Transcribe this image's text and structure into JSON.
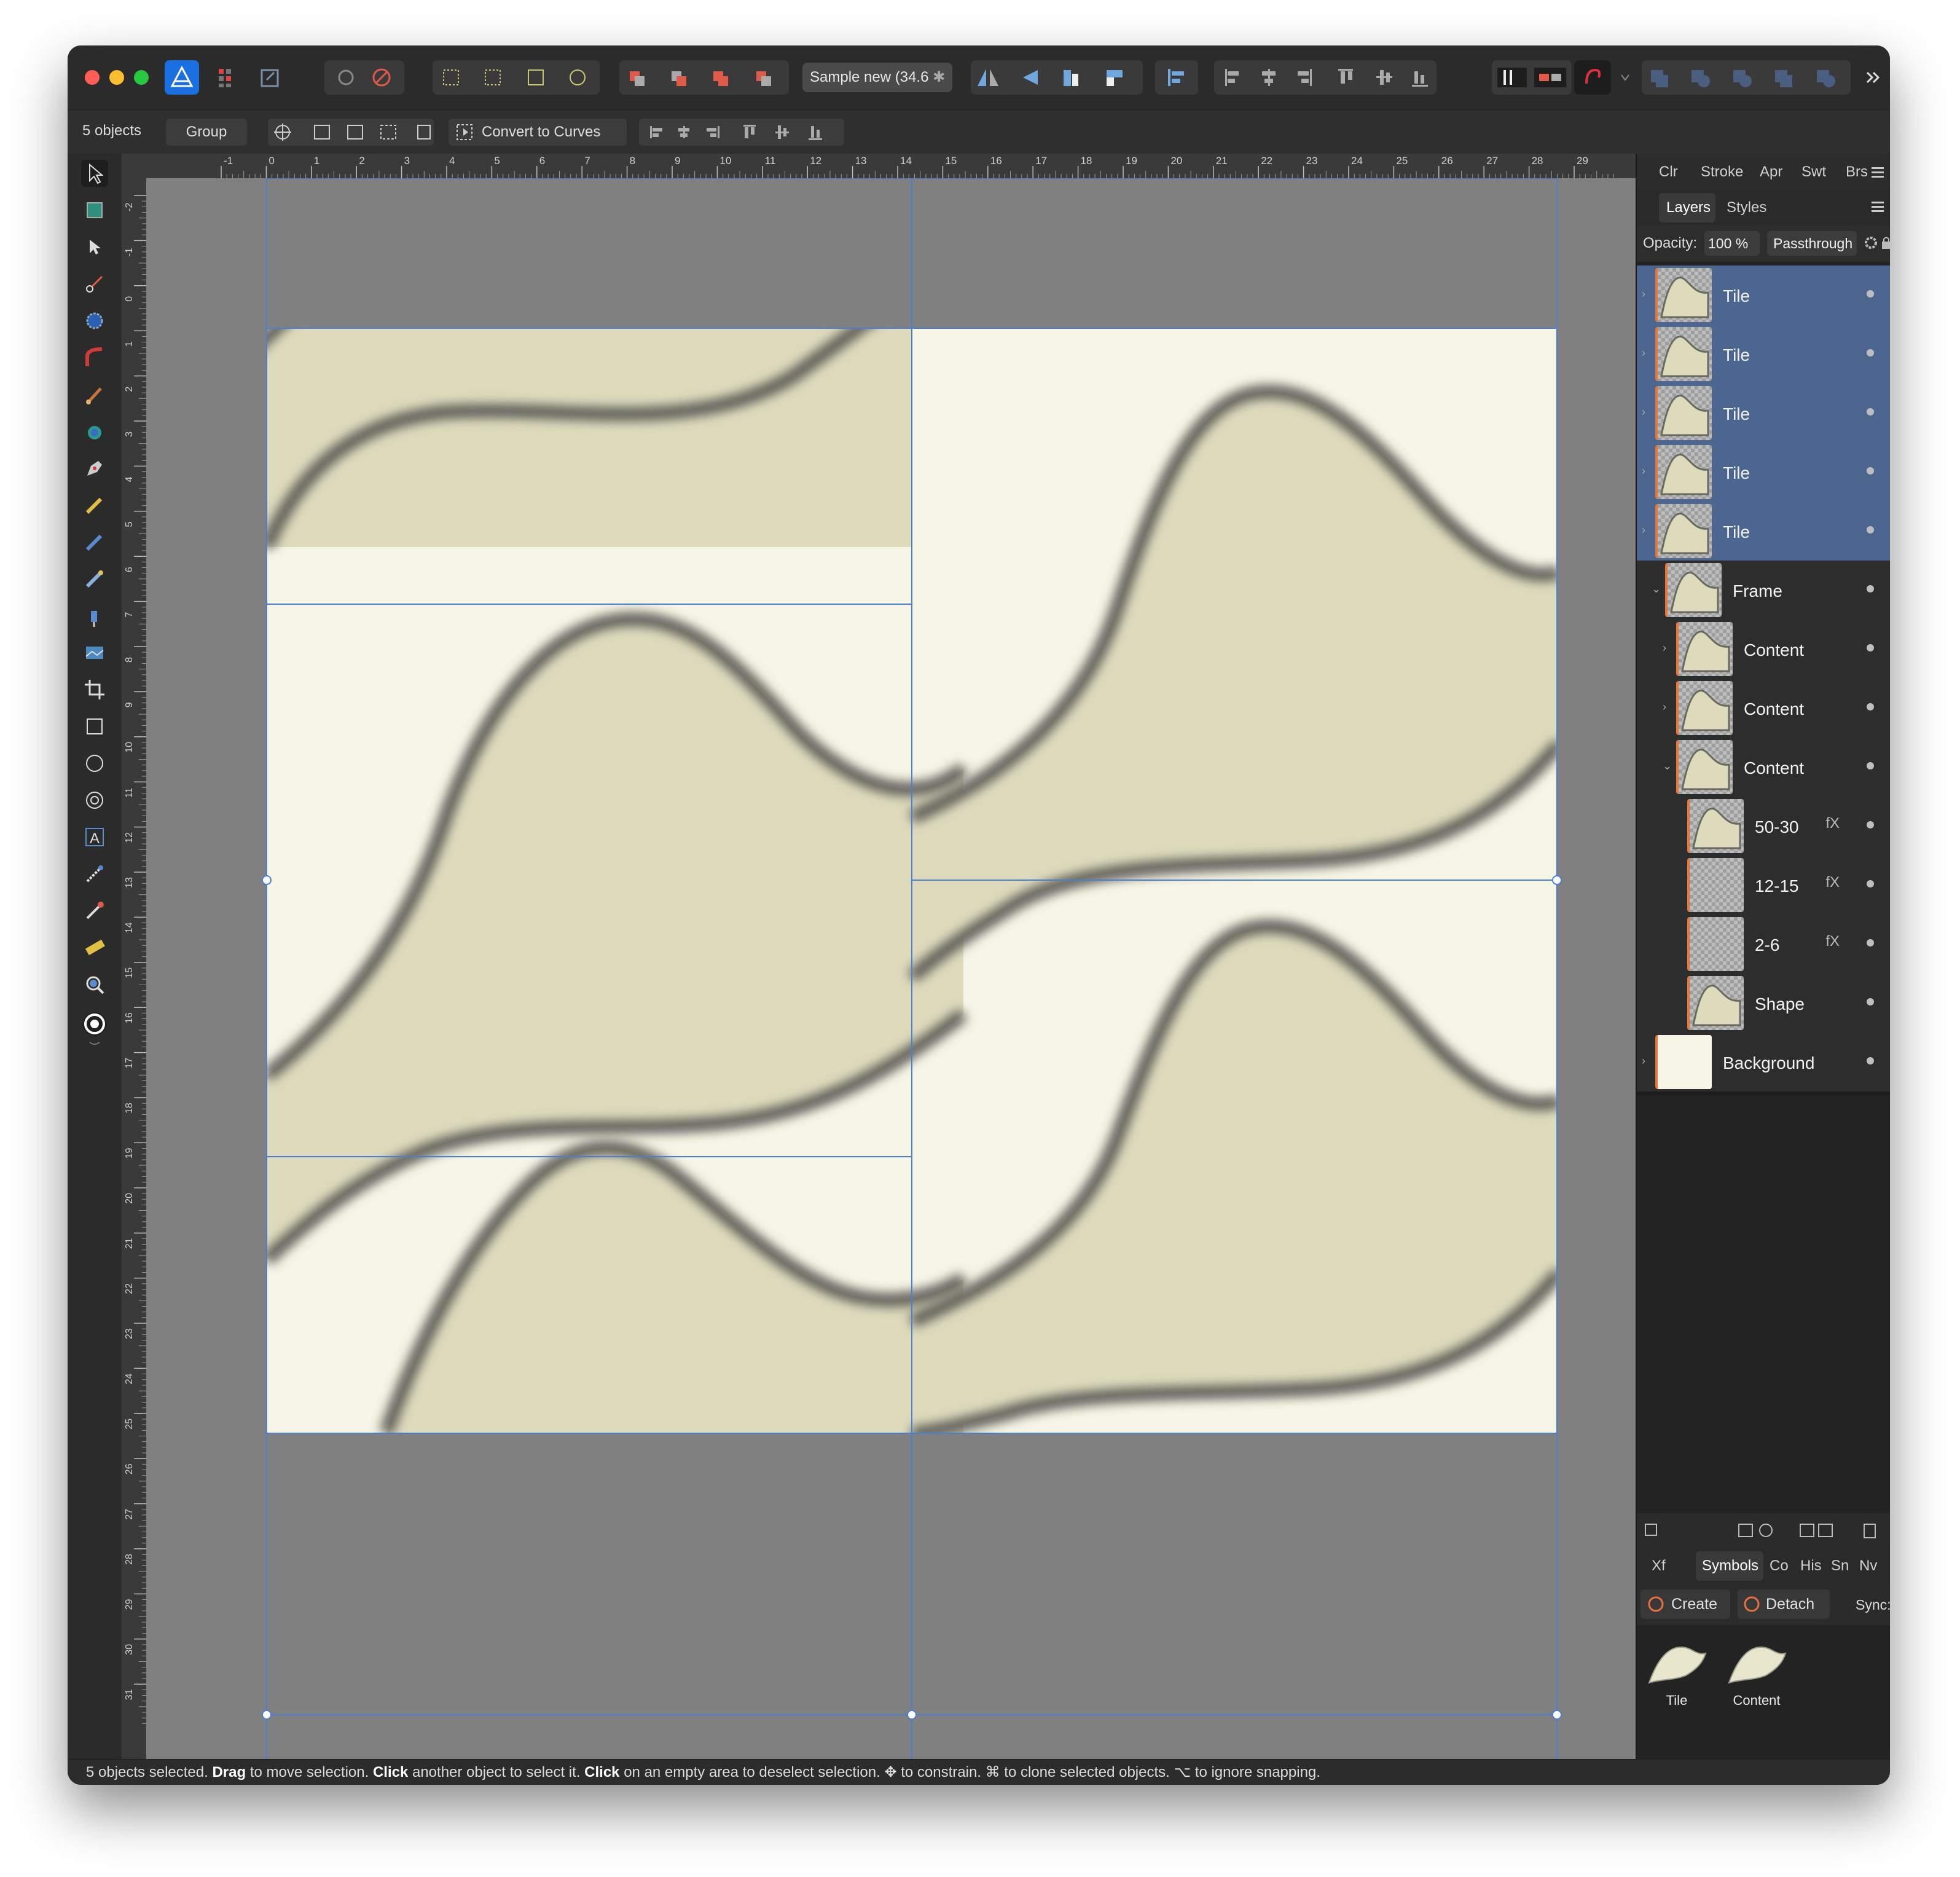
{
  "toolbar": {
    "document_title": "Sample new (34.6",
    "document_title_suffix": "✱"
  },
  "context_bar": {
    "selection_count": "5 objects",
    "group_label": "Group",
    "convert_label": "Convert to Curves"
  },
  "rulers": {
    "unit": "in",
    "h_ticks": [
      "-1",
      "0",
      "1",
      "2",
      "3",
      "4",
      "5",
      "6",
      "7",
      "8",
      "9",
      "10",
      "11",
      "12",
      "13",
      "14",
      "15",
      "16",
      "17",
      "18",
      "19",
      "20",
      "21",
      "22",
      "23",
      "24",
      "25",
      "26",
      "27",
      "28",
      "29"
    ],
    "v_ticks": [
      "-2",
      "-1",
      "0",
      "1",
      "2",
      "3",
      "4",
      "5",
      "6",
      "7",
      "8",
      "9",
      "10",
      "11",
      "12",
      "13",
      "14",
      "15",
      "16",
      "17",
      "18",
      "19",
      "20",
      "21",
      "22",
      "23",
      "24",
      "25",
      "26",
      "27",
      "28",
      "29",
      "30",
      "31"
    ]
  },
  "panels": {
    "top_tabs": [
      "Clr",
      "Stroke",
      "Apr",
      "Swt",
      "Brs"
    ],
    "layer_tabs": [
      "Layers",
      "Styles"
    ],
    "opacity_label": "Opacity:",
    "opacity_value": "100 %",
    "blend_mode": "Passthrough",
    "bottom_tabs": [
      "Xf",
      "Symbols",
      "Co",
      "His",
      "Sn",
      "Nv"
    ],
    "symbols_create": "Create",
    "symbols_detach": "Detach",
    "symbols_sync": "Sync:"
  },
  "layers": [
    {
      "name": "Tile",
      "selected": true,
      "indent": 0
    },
    {
      "name": "Tile",
      "selected": true,
      "indent": 0
    },
    {
      "name": "Tile",
      "selected": true,
      "indent": 0
    },
    {
      "name": "Tile",
      "selected": true,
      "indent": 0
    },
    {
      "name": "Tile",
      "selected": true,
      "indent": 0
    },
    {
      "name": "Frame",
      "selected": false,
      "indent": 1
    },
    {
      "name": "Content",
      "selected": false,
      "indent": 2
    },
    {
      "name": "Content",
      "selected": false,
      "indent": 2
    },
    {
      "name": "Content",
      "selected": false,
      "indent": 2
    },
    {
      "name": "50-30",
      "selected": false,
      "indent": 3,
      "fx": "fX"
    },
    {
      "name": "12-15",
      "selected": false,
      "indent": 3,
      "fx": "fX"
    },
    {
      "name": "2-6",
      "selected": false,
      "indent": 3,
      "fx": "fX"
    },
    {
      "name": "Shape",
      "selected": false,
      "indent": 3
    },
    {
      "name": "Background",
      "selected": false,
      "indent": 0
    }
  ],
  "symbols": [
    {
      "name": "Tile"
    },
    {
      "name": "Content"
    }
  ],
  "status": {
    "p1": "5 objects selected.",
    "k1": "Drag",
    "p2": "to move selection.",
    "k2": "Click",
    "p3": "another object to select it.",
    "k3": "Click",
    "p4": "on an empty area to deselect selection. ✥ to constrain. ⌘ to clone selected objects. ⌥ to ignore snapping."
  },
  "colors": {
    "accent": "#4c6690",
    "paper": "#f7f6e6",
    "shape": "#dedbbd",
    "shadow": "#5a5a55",
    "pasteboard": "#808080",
    "selection": "#4a7fd4"
  }
}
